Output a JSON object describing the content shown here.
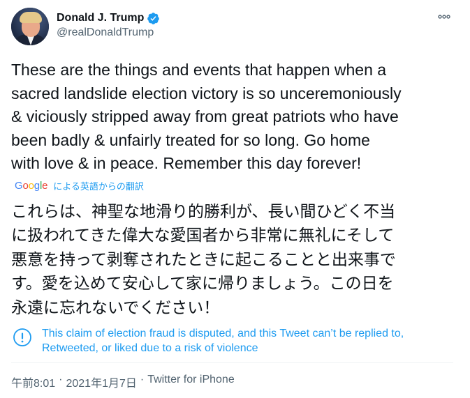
{
  "author": {
    "display_name": "Donald J. Trump",
    "handle": "@realDonaldTrump",
    "verified": true
  },
  "tweet": {
    "text": "These are the things and events that happen when a\nsacred landslide election victory is so unceremoniously\n& viciously stripped away from great patriots who have\nbeen badly & unfairly treated for so long. Go home\nwith love & in peace. Remember this day forever!",
    "translation_provider": "Google",
    "translation_label": "による英語からの翻訳",
    "translated_text": "これらは、神聖な地滑り的勝利が、長い間ひどく不当\nに扱われてきた偉大な愛国者から非常に無礼にそして\n悪意を持って剥奪されたときに起こることと出来事で\nす。愛を込めて安心して家に帰りましょう。この日を\n永遠に忘れないでください！"
  },
  "notice": {
    "text": "This claim of election fraud is disputed, and this Tweet can’t be replied to,\nRetweeted, or liked due to a risk of violence",
    "icon": "exclamation-circle-icon"
  },
  "meta": {
    "time": "午前8:01",
    "separator": "·",
    "date": "2021年1月7日",
    "source": "Twitter for iPhone"
  },
  "colors": {
    "accent": "#1d9bf0",
    "text": "#0f1419",
    "secondary": "#536471",
    "verified": "#1d9bf0",
    "divider": "#eff3f4"
  }
}
